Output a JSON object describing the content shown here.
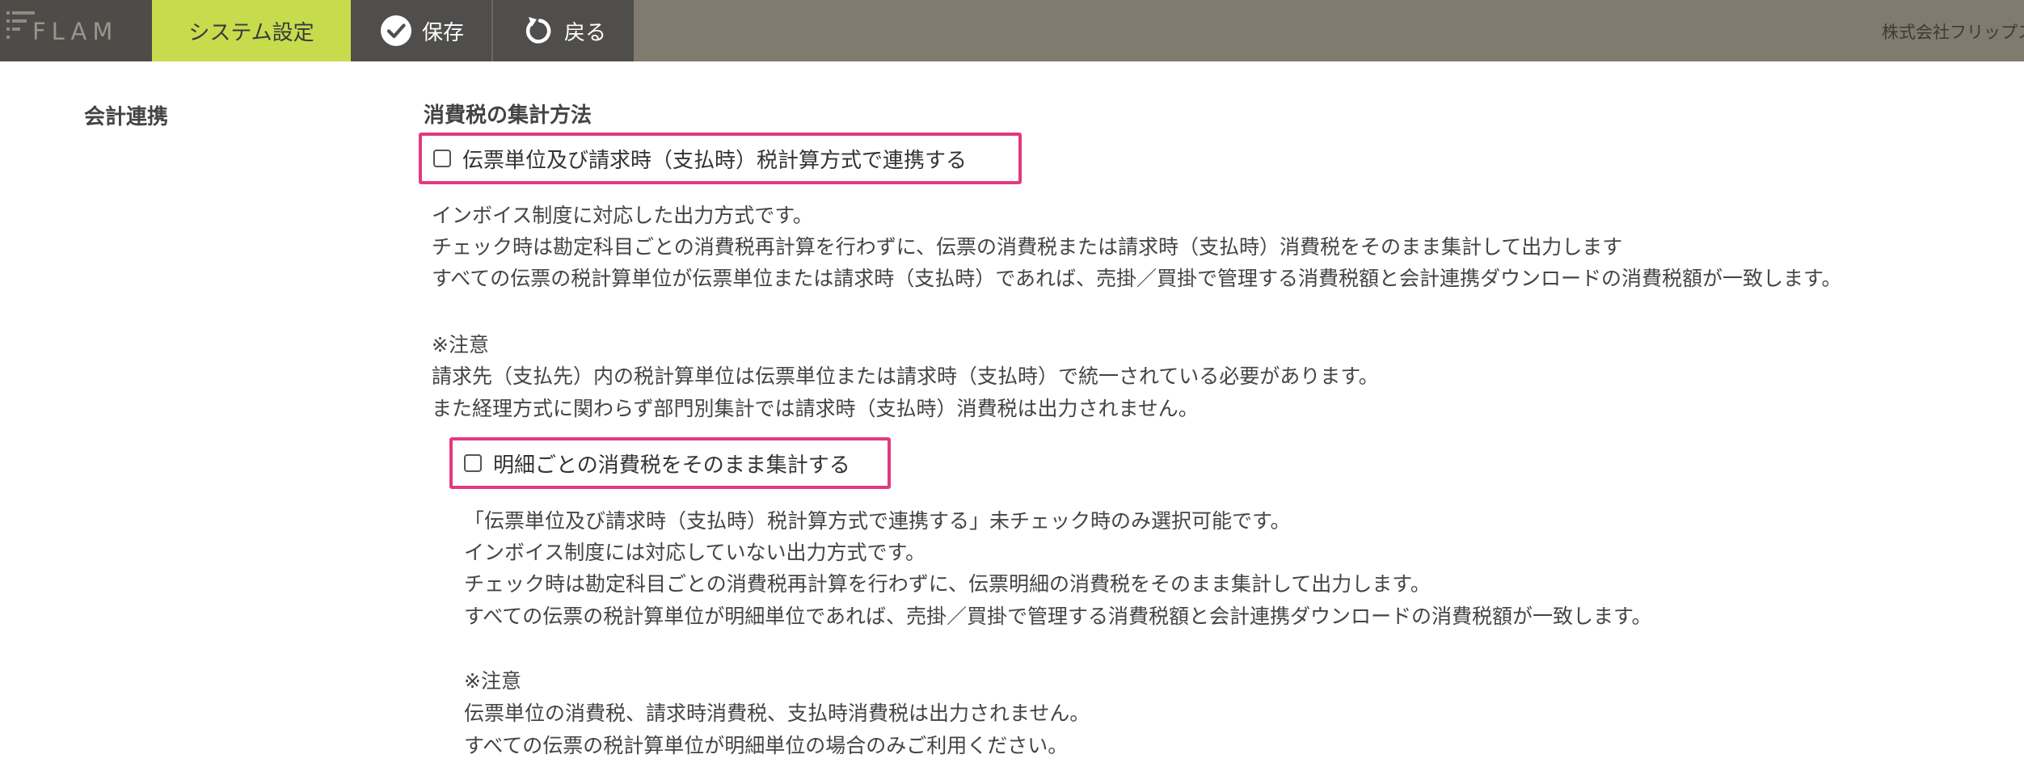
{
  "header": {
    "logo": "FLAM",
    "tab_active": "システム設定",
    "save_label": "保存",
    "back_label": "戻る",
    "company": "株式会社フリップス"
  },
  "main": {
    "section_label": "会計連携",
    "heading": "消費税の集計方法",
    "option1": {
      "label": "伝票単位及び請求時（支払時）税計算方式で連携する",
      "checked": false,
      "lines": [
        "インボイス制度に対応した出力方式です。",
        "チェック時は勘定科目ごとの消費税再計算を行わずに、伝票の消費税または請求時（支払時）消費税をそのまま集計して出力します",
        "すべての伝票の税計算単位が伝票単位または請求時（支払時）であれば、売掛／買掛で管理する消費税額と会計連携ダウンロードの消費税額が一致します。",
        "※注意",
        "請求先（支払先）内の税計算単位は伝票単位または請求時（支払時）で統一されている必要があります。",
        "また経理方式に関わらず部門別集計では請求時（支払時）消費税は出力されません。"
      ]
    },
    "option2": {
      "label": "明細ごとの消費税をそのまま集計する",
      "checked": false,
      "lines": [
        "「伝票単位及び請求時（支払時）税計算方式で連携する」未チェック時のみ選択可能です。",
        "インボイス制度には対応していない出力方式です。",
        "チェック時は勘定科目ごとの消費税再計算を行わずに、伝票明細の消費税をそのまま集計して出力します。",
        "すべての伝票の税計算単位が明細単位であれば、売掛／買掛で管理する消費税額と会計連携ダウンロードの消費税額が一致します。",
        "※注意",
        "伝票単位の消費税、請求時消費税、支払時消費税は出力されません。",
        "すべての伝票の税計算単位が明細単位の場合のみご利用ください。"
      ]
    }
  },
  "icons": {
    "save": "check-circle-icon",
    "back": "refresh-icon"
  },
  "colors": {
    "topbar": "#817a6e",
    "active_tab": "#c6dc4d",
    "button": "#4f4e4c",
    "highlight": "#e23a7e"
  }
}
